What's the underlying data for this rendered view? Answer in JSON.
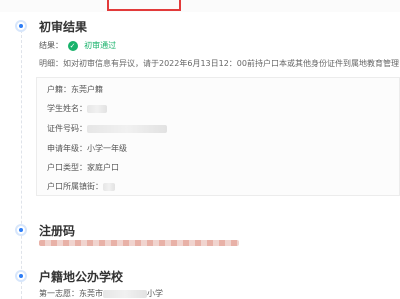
{
  "initial_review": {
    "title": "初审结果",
    "result_label": "结果：",
    "result_value": "初审通过",
    "hint_text": "明细：如对初审信息有异议，请于2022年6月13日12：00前持户口本或其他身份证件到属地教育管理部门复审"
  },
  "student_info": {
    "household_type": "户籍：东莞户籍",
    "student_name_label": "学生姓名：",
    "id_number_label": "证件号码：",
    "grade": "申请年级：小学一年级",
    "hukou_type": "户口类型：家庭户口",
    "hukou_town_label": "户口所属镇街："
  },
  "registration_code": {
    "title": "注册码"
  },
  "public_school": {
    "title": "户籍地公办学校",
    "first_choice_prefix": "第一志愿：东莞市",
    "first_choice_suffix": "小学"
  }
}
